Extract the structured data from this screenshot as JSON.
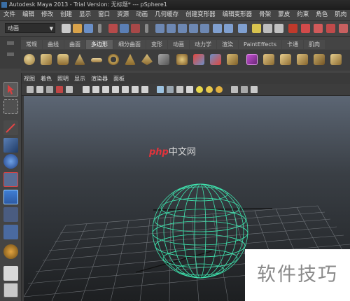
{
  "window": {
    "title": "Autodesk Maya 2013 - Trial Version: 无标题* --- pSphere1"
  },
  "menubar": {
    "items": [
      "文件",
      "编辑",
      "修改",
      "创建",
      "显示",
      "窗口",
      "资源",
      "动画",
      "几何缓存",
      "创建变形器",
      "编辑变形器",
      "骨架",
      "蒙皮",
      "约束",
      "角色",
      "肌肉"
    ]
  },
  "status_line": {
    "mode": "动画"
  },
  "shelf_tabs": {
    "items": [
      "常规",
      "曲线",
      "曲面",
      "多边形",
      "细分曲面",
      "变形",
      "动画",
      "动力学",
      "渲染",
      "PaintEffects",
      "卡通",
      "肌肉"
    ],
    "active": "多边形"
  },
  "panel_menu": {
    "items": [
      "视图",
      "着色",
      "照明",
      "显示",
      "渲染器",
      "面板"
    ]
  },
  "watermark": {
    "brand": "php",
    "site": "中文网",
    "corner_text": "软件技巧"
  },
  "colors": {
    "wireframe": "#3fe6b0",
    "viewport_top": "#5c6674",
    "viewport_bottom": "#1d1f21",
    "ui_bg": "#444444"
  }
}
